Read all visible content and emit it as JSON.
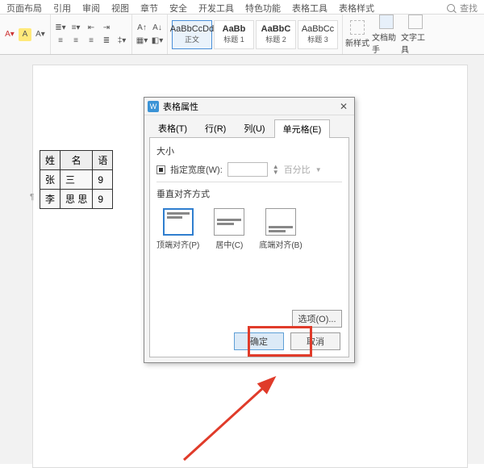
{
  "ribbon": {
    "tabs": [
      "页面布局",
      "引用",
      "审阅",
      "视图",
      "章节",
      "安全",
      "开发工具",
      "特色功能",
      "表格工具",
      "表格样式"
    ],
    "search": "查找"
  },
  "styles": {
    "items": [
      {
        "sample": "AaBbCcDd",
        "label": "正文"
      },
      {
        "sample": "AaBb",
        "label": "标题 1"
      },
      {
        "sample": "AaBbC",
        "label": "标题 2"
      },
      {
        "sample": "AaBbCc",
        "label": "标题 3"
      }
    ]
  },
  "bigButtons": {
    "newStyle": "新样式",
    "docHelper": "文档助手",
    "textTool": "文字工具"
  },
  "table": {
    "headers": [
      "姓",
      "名",
      "语"
    ],
    "rows": [
      [
        "张",
        "三",
        "9"
      ],
      [
        "李",
        "思  思",
        "9"
      ]
    ]
  },
  "dialog": {
    "title": "表格属性",
    "tabs": {
      "table": "表格(T)",
      "row": "行(R)",
      "col": "列(U)",
      "cell": "单元格(E)"
    },
    "size": {
      "label": "大小",
      "widthCheck": "指定宽度(W):",
      "unit": "百分比"
    },
    "valign": {
      "label": "垂直对齐方式",
      "top": "顶端对齐(P)",
      "mid": "居中(C)",
      "bot": "底端对齐(B)"
    },
    "options": "选项(O)...",
    "ok": "确定",
    "cancel": "取消"
  }
}
